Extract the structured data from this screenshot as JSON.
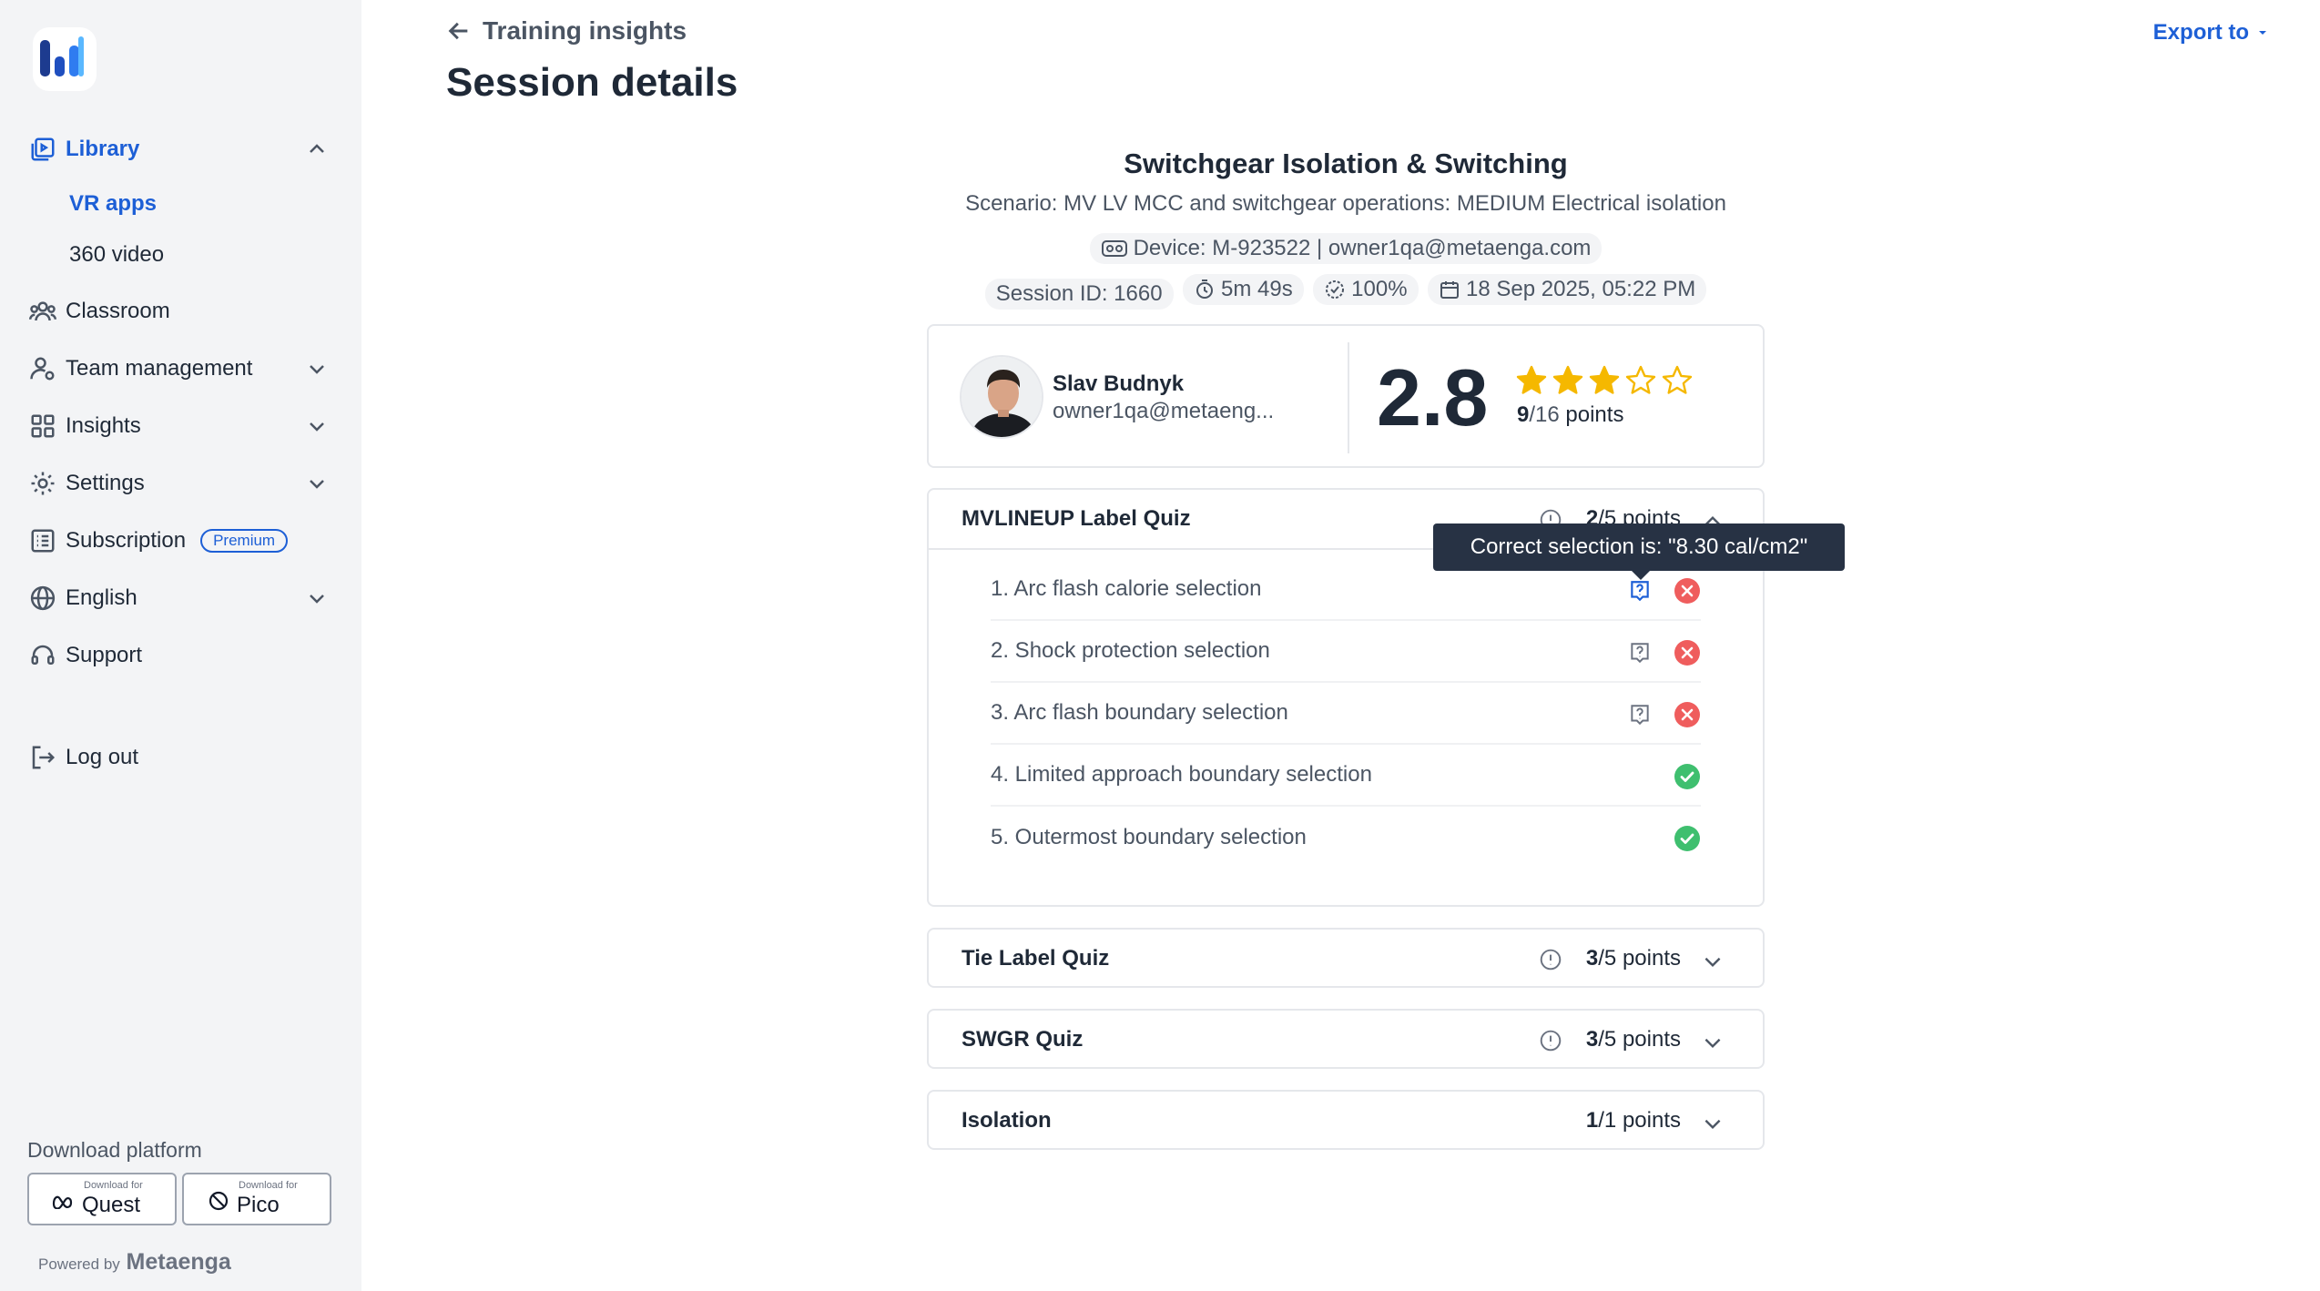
{
  "sidebar": {
    "items": {
      "library": "Library",
      "vr_apps": "VR apps",
      "video_360": "360 video",
      "classroom": "Classroom",
      "team_management": "Team management",
      "insights": "Insights",
      "settings": "Settings",
      "subscription": "Subscription",
      "premium_badge": "Premium",
      "language": "English",
      "support": "Support",
      "logout": "Log out"
    },
    "download": {
      "title": "Download platform",
      "quest_small": "Download for",
      "quest": "Quest",
      "pico_small": "Download for",
      "pico": "Pico"
    },
    "powered_by": "Powered by",
    "brand": "Metaenga"
  },
  "header": {
    "back_label": "Training insights",
    "title": "Session details",
    "export_label": "Export to"
  },
  "session": {
    "title": "Switchgear Isolation & Switching",
    "scenario": "Scenario: MV LV MCC and switchgear operations: MEDIUM Electrical isolation",
    "device": "Device: M-923522 | owner1qa@metaenga.com",
    "session_id": "Session ID: 1660",
    "duration": "5m 49s",
    "completion": "100%",
    "datetime": "18 Sep 2025, 05:22 PM"
  },
  "user": {
    "name": "Slav Budnyk",
    "email": "owner1qa@metaeng..."
  },
  "score": {
    "value": "2.8",
    "rating_out_of_5": 2.8,
    "points_earned": "9",
    "points_total": "/16",
    "points_label": "points"
  },
  "quizzes": [
    {
      "title": "MVLINEUP Label Quiz",
      "earned": "2",
      "total": "/5",
      "label": "points",
      "expanded": true,
      "questions": [
        {
          "text": "1. Arc flash calorie selection",
          "correct": false
        },
        {
          "text": "2. Shock protection selection",
          "correct": false
        },
        {
          "text": "3. Arc flash boundary selection",
          "correct": false
        },
        {
          "text": "4. Limited approach boundary selection",
          "correct": true
        },
        {
          "text": "5. Outermost boundary selection",
          "correct": true
        }
      ]
    },
    {
      "title": "Tie Label Quiz",
      "earned": "3",
      "total": "/5",
      "label": "points"
    },
    {
      "title": "SWGR Quiz",
      "earned": "3",
      "total": "/5",
      "label": "points"
    },
    {
      "title": "Isolation",
      "earned": "1",
      "total": "/1",
      "label": "points"
    }
  ],
  "tooltip": "Correct selection is: \"8.30 cal/cm2\"",
  "colors": {
    "accent": "#1d5fd6",
    "star": "#f5b800",
    "error": "#ef5d5d",
    "success": "#3fbf6f"
  }
}
